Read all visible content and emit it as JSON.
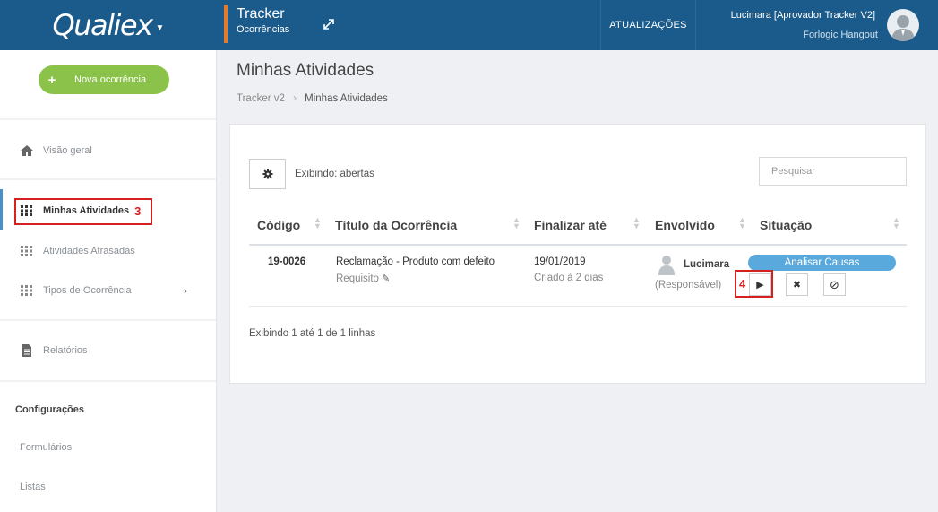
{
  "header": {
    "logo": "Qualiex",
    "module_title": "Tracker",
    "module_sub": "Ocorrências",
    "updates_label": "ATUALIZAÇÕES",
    "user_name": "Lucimara [Aprovador Tracker V2]",
    "user_org": "Forlogic Hangout"
  },
  "sidebar": {
    "new_button": "Nova ocorrência",
    "items": [
      {
        "label": "Visão geral",
        "icon": "home-icon"
      },
      {
        "label": "Minhas Atividades",
        "icon": "grid-icon",
        "active": true
      },
      {
        "label": "Atividades Atrasadas",
        "icon": "grid-icon"
      },
      {
        "label": "Tipos de Ocorrência",
        "icon": "grid-icon"
      },
      {
        "label": "Relatórios",
        "icon": "report-icon"
      }
    ],
    "settings_title": "Configurações",
    "links": [
      "Formulários",
      "Listas"
    ]
  },
  "annotations": {
    "step3": "3",
    "step4": "4"
  },
  "main": {
    "title": "Minhas Atividades",
    "breadcrumb": [
      "Tracker v2",
      "Minhas Atividades"
    ],
    "showing_label": "Exibindo: abertas",
    "search_placeholder": "Pesquisar",
    "columns": [
      "Código",
      "Título da Ocorrência",
      "Finalizar até",
      "Envolvido",
      "Situação"
    ],
    "rows": [
      {
        "code": "19-0026",
        "title": "Reclamação - Produto com defeito",
        "type": "Requisito",
        "due": "19/01/2019",
        "created": "Criado à 2 dias",
        "person": "Lucimara",
        "role": "(Responsável)",
        "status": "Analisar Causas"
      }
    ],
    "footer": "Exibindo 1 até 1 de 1 linhas"
  },
  "colors": {
    "header_bg": "#1b5b8b",
    "accent_orange": "#e8792c",
    "green": "#8bc34a",
    "status_blue": "#5aa9dd",
    "annotation_red": "#d62020"
  }
}
